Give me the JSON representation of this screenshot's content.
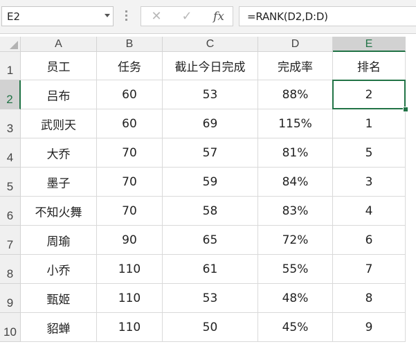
{
  "name_box": "E2",
  "formula": "=RANK(D2,D:D)",
  "buttons": {
    "cancel": "✕",
    "enter": "✓",
    "fx": "fx"
  },
  "columns": [
    "A",
    "B",
    "C",
    "D",
    "E"
  ],
  "selected_column": "E",
  "selected_row": "2",
  "rows": [
    {
      "num": "1",
      "cells": [
        "员工",
        "任务",
        "截止今日完成",
        "完成率",
        "排名"
      ]
    },
    {
      "num": "2",
      "cells": [
        "吕布",
        "60",
        "53",
        "88%",
        "2"
      ]
    },
    {
      "num": "3",
      "cells": [
        "武则天",
        "60",
        "69",
        "115%",
        "1"
      ]
    },
    {
      "num": "4",
      "cells": [
        "大乔",
        "70",
        "57",
        "81%",
        "5"
      ]
    },
    {
      "num": "5",
      "cells": [
        "墨子",
        "70",
        "59",
        "84%",
        "3"
      ]
    },
    {
      "num": "6",
      "cells": [
        "不知火舞",
        "70",
        "58",
        "83%",
        "4"
      ]
    },
    {
      "num": "7",
      "cells": [
        "周瑜",
        "90",
        "65",
        "72%",
        "6"
      ]
    },
    {
      "num": "8",
      "cells": [
        "小乔",
        "110",
        "61",
        "55%",
        "7"
      ]
    },
    {
      "num": "9",
      "cells": [
        "甄姬",
        "110",
        "53",
        "48%",
        "8"
      ]
    },
    {
      "num": "10",
      "cells": [
        "貂蝉",
        "110",
        "50",
        "45%",
        "9"
      ]
    }
  ],
  "colors": {
    "accent": "#217346",
    "header_bg": "#f0f0f0",
    "header_selected_bg": "#d2d2d2"
  }
}
